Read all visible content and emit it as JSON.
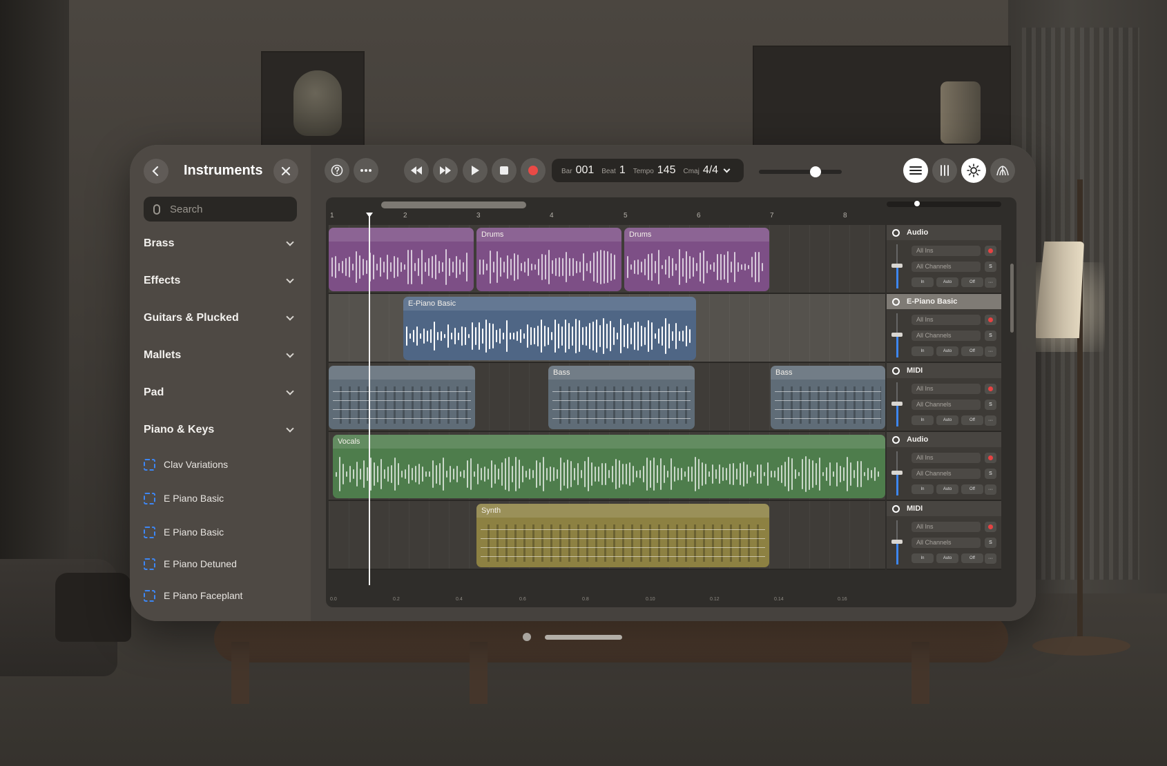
{
  "sidebar": {
    "title": "Instruments",
    "search_placeholder": "Search",
    "categories": [
      {
        "label": "Brass"
      },
      {
        "label": "Effects"
      },
      {
        "label": "Guitars & Plucked"
      },
      {
        "label": "Mallets"
      },
      {
        "label": "Pad"
      },
      {
        "label": "Piano & Keys"
      }
    ],
    "items": [
      {
        "label": "Clav Variations"
      },
      {
        "label": "E Piano Basic"
      },
      {
        "label": "E Piano Basic"
      },
      {
        "label": "E Piano Detuned"
      },
      {
        "label": "E Piano Faceplant"
      }
    ]
  },
  "toolbar": {
    "bar_label": "Bar",
    "bar_value": "001",
    "beat_label": "Beat",
    "beat_value": "1",
    "tempo_label": "Tempo",
    "tempo_value": "145",
    "key_label": "Cmaj",
    "signature_value": "4/4",
    "volume_level": 0.68
  },
  "ruler": {
    "bars": [
      "1",
      "2",
      "3",
      "4",
      "5",
      "6",
      "7",
      "8"
    ],
    "time_marks": [
      "0.0",
      "0.2",
      "0.4",
      "0.6",
      "0.8",
      "0.10",
      "0.12",
      "0.14",
      "0.16"
    ]
  },
  "tracks": [
    {
      "regions": [
        {
          "name": "",
          "color": "#7d4f86",
          "kind": "audio"
        },
        {
          "name": "Drums",
          "color": "#7d4f86",
          "kind": "audio"
        },
        {
          "name": "Drums",
          "color": "#7d4f86",
          "kind": "audio"
        }
      ]
    },
    {
      "regions": [
        {
          "name": "E-Piano Basic",
          "color": "#4f6685",
          "kind": "audio"
        }
      ]
    },
    {
      "regions": [
        {
          "name": "",
          "color": "#5f6c77",
          "kind": "midi"
        },
        {
          "name": "Bass",
          "color": "#5f6c77",
          "kind": "midi"
        },
        {
          "name": "Bass",
          "color": "#5f6c77",
          "kind": "midi"
        }
      ]
    },
    {
      "regions": [
        {
          "name": "Vocals",
          "color": "#4e7d4c",
          "kind": "audio"
        }
      ]
    },
    {
      "regions": [
        {
          "name": "Synth",
          "color": "#8d8142",
          "kind": "midi"
        }
      ]
    }
  ],
  "mixer": {
    "input_label": "All Ins",
    "channel_label": "All Channels",
    "solo_label": "S",
    "in_label": "In",
    "auto_label": "Auto",
    "off_label": "Off",
    "more_label": "···",
    "strips": [
      {
        "name": "Audio"
      },
      {
        "name": "E-Piano Basic"
      },
      {
        "name": "MIDI"
      },
      {
        "name": "Audio"
      },
      {
        "name": "MIDI"
      }
    ]
  }
}
